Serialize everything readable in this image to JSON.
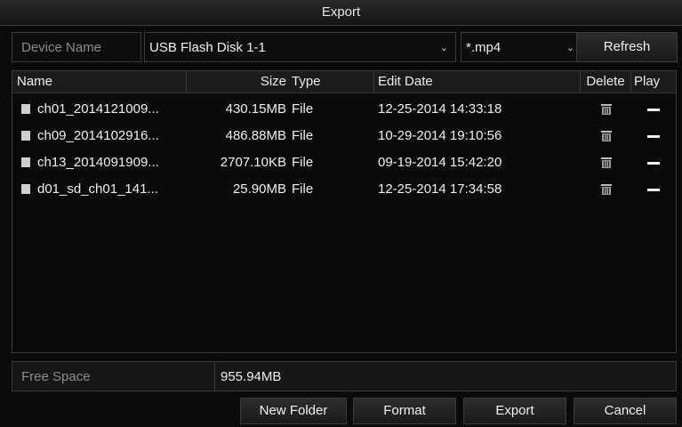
{
  "title": "Export",
  "toolbar": {
    "device_label": "Device Name",
    "device_value": "USB Flash Disk 1-1",
    "ext_value": "*.mp4",
    "refresh_label": "Refresh"
  },
  "table": {
    "headers": {
      "name": "Name",
      "size": "Size",
      "type": "Type",
      "date": "Edit Date",
      "delete": "Delete",
      "play": "Play"
    },
    "rows": [
      {
        "name": "ch01_2014121009...",
        "size": "430.15MB",
        "type": "File",
        "date": "12-25-2014 14:33:18"
      },
      {
        "name": "ch09_2014102916...",
        "size": "486.88MB",
        "type": "File",
        "date": "10-29-2014 19:10:56"
      },
      {
        "name": "ch13_2014091909...",
        "size": "2707.10KB",
        "type": "File",
        "date": "09-19-2014 15:42:20"
      },
      {
        "name": "d01_sd_ch01_141...",
        "size": "25.90MB",
        "type": "File",
        "date": "12-25-2014 17:34:58"
      }
    ]
  },
  "free_space": {
    "label": "Free Space",
    "value": "955.94MB"
  },
  "footer": {
    "new_folder": "New Folder",
    "format": "Format",
    "export": "Export",
    "cancel": "Cancel"
  },
  "icons": {
    "file": "file-icon",
    "delete": "trash-icon",
    "play": "dash-icon",
    "dropdown": "chevron-down-icon"
  },
  "colors": {
    "background": "#0b0b0b",
    "text": "#f0f0f0",
    "muted_text": "#8c8c8c",
    "border": "#3a3a3a"
  }
}
